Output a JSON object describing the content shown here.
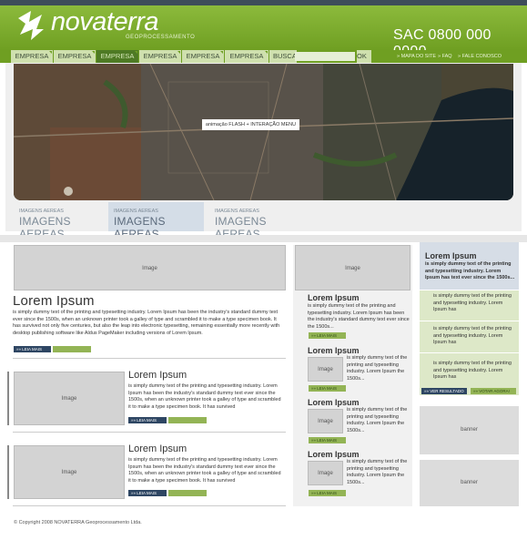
{
  "header": {
    "logo_text": "novaterra",
    "logo_sub": "GEOPROCESSAMENTO",
    "sac": "SAC 0800 000 0000"
  },
  "nav": {
    "tabs": [
      {
        "label": "EMPRESA"
      },
      {
        "label": "EMPRESA"
      },
      {
        "label": "EMPRESA",
        "active": true
      },
      {
        "label": "EMPRESA"
      },
      {
        "label": "EMPRESA"
      },
      {
        "label": "EMPRESA"
      }
    ],
    "busca_label": "BUSCA",
    "busca_ok": "OK",
    "links": [
      "» MAPA DO SITE",
      "» FAQ",
      "» FALE CONOSCO"
    ]
  },
  "hero": {
    "flash_label": "animação FLASH + INTERAÇÃO MENU",
    "tabs": [
      {
        "small": "IMAGENS AEREAS",
        "big": "IMAGENS AEREAS"
      },
      {
        "small": "IMAGENS AEREAS",
        "big": "IMAGENS AEREAS",
        "active": true
      },
      {
        "small": "IMAGENS AEREAS",
        "big": "IMAGENS AEREAS"
      }
    ]
  },
  "main": {
    "image_label": "Image",
    "lead": {
      "title": "Lorem Ipsum",
      "text": "is simply dummy text of the printing and typesetting industry. Lorem Ipsum has been the industry's standard dummy text ever since the 1500s, when an unknown printer took a galley of type and scrambled it to make a type specimen book. It has survived not only five centuries, but also the leap into electronic typesetting, remaining essentially more recently with desktop publishing software like Aldus PageMaker including versions of Lorem Ipsum.",
      "more": "»» LEIA MAIS"
    },
    "items": [
      {
        "title": "Lorem Ipsum",
        "text": "is simply dummy text of the printing and typesetting industry. Lorem Ipsum has been the industry's standard dummy text ever since the 1500s, when an unknown printer took a galley of type and scrambled it to make a type specimen book. It has survived",
        "more": "»» LEIA MAIS"
      },
      {
        "title": "Lorem Ipsum",
        "text": "is simply dummy text of the printing and typesetting industry. Lorem Ipsum has been the industry's standard dummy text ever since the 1500s, when an unknown printer took a galley of type and scrambled it to make a type specimen book. It has survived",
        "more": "»» LEIA MAIS"
      }
    ]
  },
  "middle": {
    "image_label": "Image",
    "first": {
      "title": "Lorem Ipsum",
      "text": "is simply dummy text of the printing and typesetting industry. Lorem Ipsum has been the industry's standard dummy text ever since the 1500s...",
      "more": "»» LEIA MAIS"
    },
    "items": [
      {
        "title": "Lorem Ipsum",
        "text": "is simply dummy text of the printing and typesetting industry. Lorem Ipsum the 1500s...",
        "more": "»» LEIA MAIS",
        "image": "Image"
      },
      {
        "title": "Lorem Ipsum",
        "text": "is simply dummy text of the printing and typesetting industry. Lorem Ipsum the 1500s...",
        "more": "»» LEIA MAIS",
        "image": "Image"
      },
      {
        "title": "Lorem Ipsum",
        "text": "is simply dummy text of the printing and typesetting industry. Lorem Ipsum the 1500s...",
        "more": "»» LEIA MAIS",
        "image": "Image"
      }
    ]
  },
  "poll": {
    "title": "Lorem Ipsum",
    "text": "is simply dummy text of the printing and typesetting industry. Lorem Ipsum has text ever since the 1500s...",
    "options": [
      "is simply dummy text of the printing and typesetting industry. Lorem Ipsum has",
      "is simply dummy text of the printing and typesetting industry. Lorem Ipsum has",
      "is simply dummy text of the printing and typesetting industry. Lorem Ipsum has"
    ],
    "result_btn": "»» VER RESULTADO",
    "vote_btn": "»» VOTAR AGORA!"
  },
  "banners": [
    "banner",
    "banner"
  ],
  "footer": "© Copyright 2008 NOVATERRA Geoprocessamento Ltda."
}
